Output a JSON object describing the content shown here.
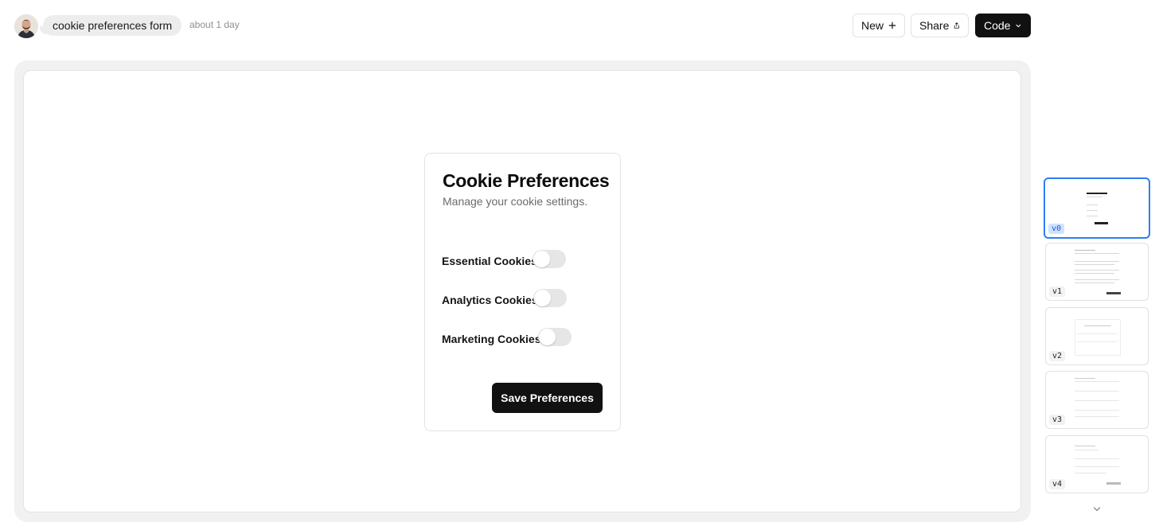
{
  "header": {
    "prompt": "cookie preferences form",
    "timestamp": "about 1 day",
    "new_label": "New",
    "share_label": "Share",
    "code_label": "Code"
  },
  "card": {
    "title": "Cookie Preferences",
    "subtitle": "Manage your cookie settings.",
    "preferences": [
      {
        "label": "Essential Cookies",
        "enabled": false
      },
      {
        "label": "Analytics Cookies",
        "enabled": false
      },
      {
        "label": "Marketing Cookies",
        "enabled": false
      }
    ],
    "save_label": "Save Preferences"
  },
  "versions": [
    {
      "label": "v0",
      "active": true
    },
    {
      "label": "v1",
      "active": false
    },
    {
      "label": "v2",
      "active": false
    },
    {
      "label": "v3",
      "active": false
    },
    {
      "label": "v4",
      "active": false
    }
  ],
  "colors": {
    "accent": "#2f7df6",
    "primary_button": "#111111",
    "toggle_off": "#e6e6e6"
  },
  "icons": [
    "plus-icon",
    "share-icon",
    "chevron-down-icon",
    "avatar"
  ]
}
